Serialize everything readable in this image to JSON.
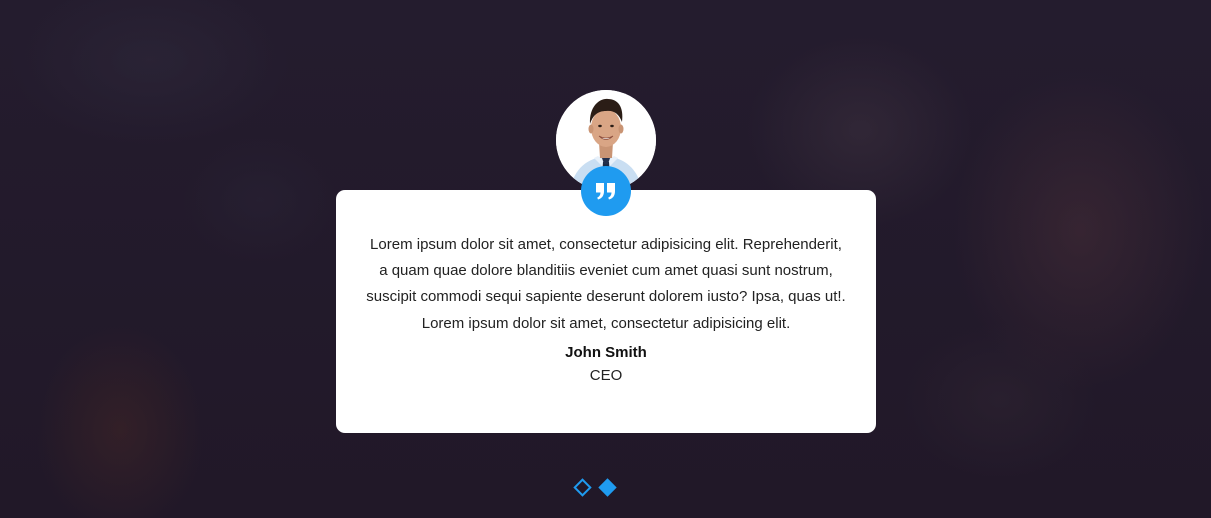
{
  "testimonial": {
    "quote": "Lorem ipsum dolor sit amet, consectetur adipisicing elit. Reprehenderit, a quam quae dolore blanditiis eveniet cum amet quasi sunt nostrum, suscipit commodi sequi sapiente deserunt dolorem iusto? Ipsa, quas ut!. Lorem ipsum dolor sit amet, consectetur adipisicing elit.",
    "author_name": "John Smith",
    "author_role": "CEO",
    "avatar_icon": "person-photo",
    "quote_icon": "quote-icon"
  },
  "pagination": {
    "total": 2,
    "active_index": 1
  },
  "colors": {
    "accent": "#1f9bf0",
    "card_bg": "#ffffff",
    "page_bg": "#231a2c"
  }
}
